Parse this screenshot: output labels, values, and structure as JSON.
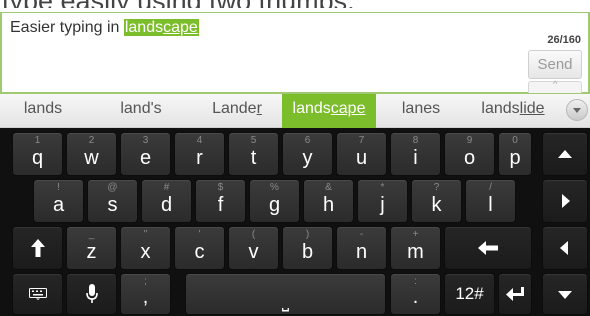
{
  "headline": "type easily using two thumbs.",
  "message": {
    "prefix": "Easier typing in ",
    "highlight_a": "lands",
    "highlight_b": "cape",
    "counter": "26/160",
    "send_label": "Send",
    "hidden_key_hint": "^"
  },
  "suggestions": [
    {
      "pre": "lands",
      "und": "",
      "post": ""
    },
    {
      "pre": "land's",
      "und": "",
      "post": ""
    },
    {
      "pre": "Lande",
      "und": "r",
      "post": ""
    },
    {
      "pre": "lands",
      "und": "cape",
      "post": ""
    },
    {
      "pre": "lanes",
      "und": "",
      "post": ""
    },
    {
      "pre": "lands",
      "und": "lide",
      "post": ""
    }
  ],
  "keyboard": {
    "row1": [
      {
        "main": "q",
        "hint": "1"
      },
      {
        "main": "w",
        "hint": "2"
      },
      {
        "main": "e",
        "hint": "3"
      },
      {
        "main": "r",
        "hint": "4"
      },
      {
        "main": "t",
        "hint": "5"
      },
      {
        "main": "y",
        "hint": "6"
      },
      {
        "main": "u",
        "hint": "7"
      },
      {
        "main": "i",
        "hint": "8"
      },
      {
        "main": "o",
        "hint": "9"
      },
      {
        "main": "p",
        "hint": "0"
      }
    ],
    "row2": [
      {
        "main": "a",
        "hint": "!"
      },
      {
        "main": "s",
        "hint": "@"
      },
      {
        "main": "d",
        "hint": "#"
      },
      {
        "main": "f",
        "hint": "$"
      },
      {
        "main": "g",
        "hint": "%"
      },
      {
        "main": "h",
        "hint": "&"
      },
      {
        "main": "j",
        "hint": "*"
      },
      {
        "main": "k",
        "hint": "?"
      },
      {
        "main": "l",
        "hint": "/"
      }
    ],
    "row3": [
      {
        "main": "z",
        "hint": "_"
      },
      {
        "main": "x",
        "hint": "\""
      },
      {
        "main": "c",
        "hint": "'"
      },
      {
        "main": "v",
        "hint": "("
      },
      {
        "main": "b",
        "hint": ")"
      },
      {
        "main": "n",
        "hint": "-"
      },
      {
        "main": "m",
        "hint": "+"
      }
    ],
    "row4": {
      "comma_main": ",",
      "comma_hint": ";",
      "period_main": ".",
      "period_hint": ":",
      "symbols_label": "12#",
      "space_glyph": "⎵"
    },
    "icons": {
      "up": "arrow-up-icon",
      "right": "arrow-right-icon",
      "left": "arrow-left-icon",
      "down": "arrow-down-icon",
      "shift": "shift-icon",
      "backspace": "backspace-icon",
      "enter": "enter-icon",
      "keyboard": "keyboard-icon",
      "mic": "microphone-icon"
    }
  },
  "colors": {
    "accent": "#7bbd2a",
    "keyboard_bg": "#101010",
    "key": "#333333"
  }
}
